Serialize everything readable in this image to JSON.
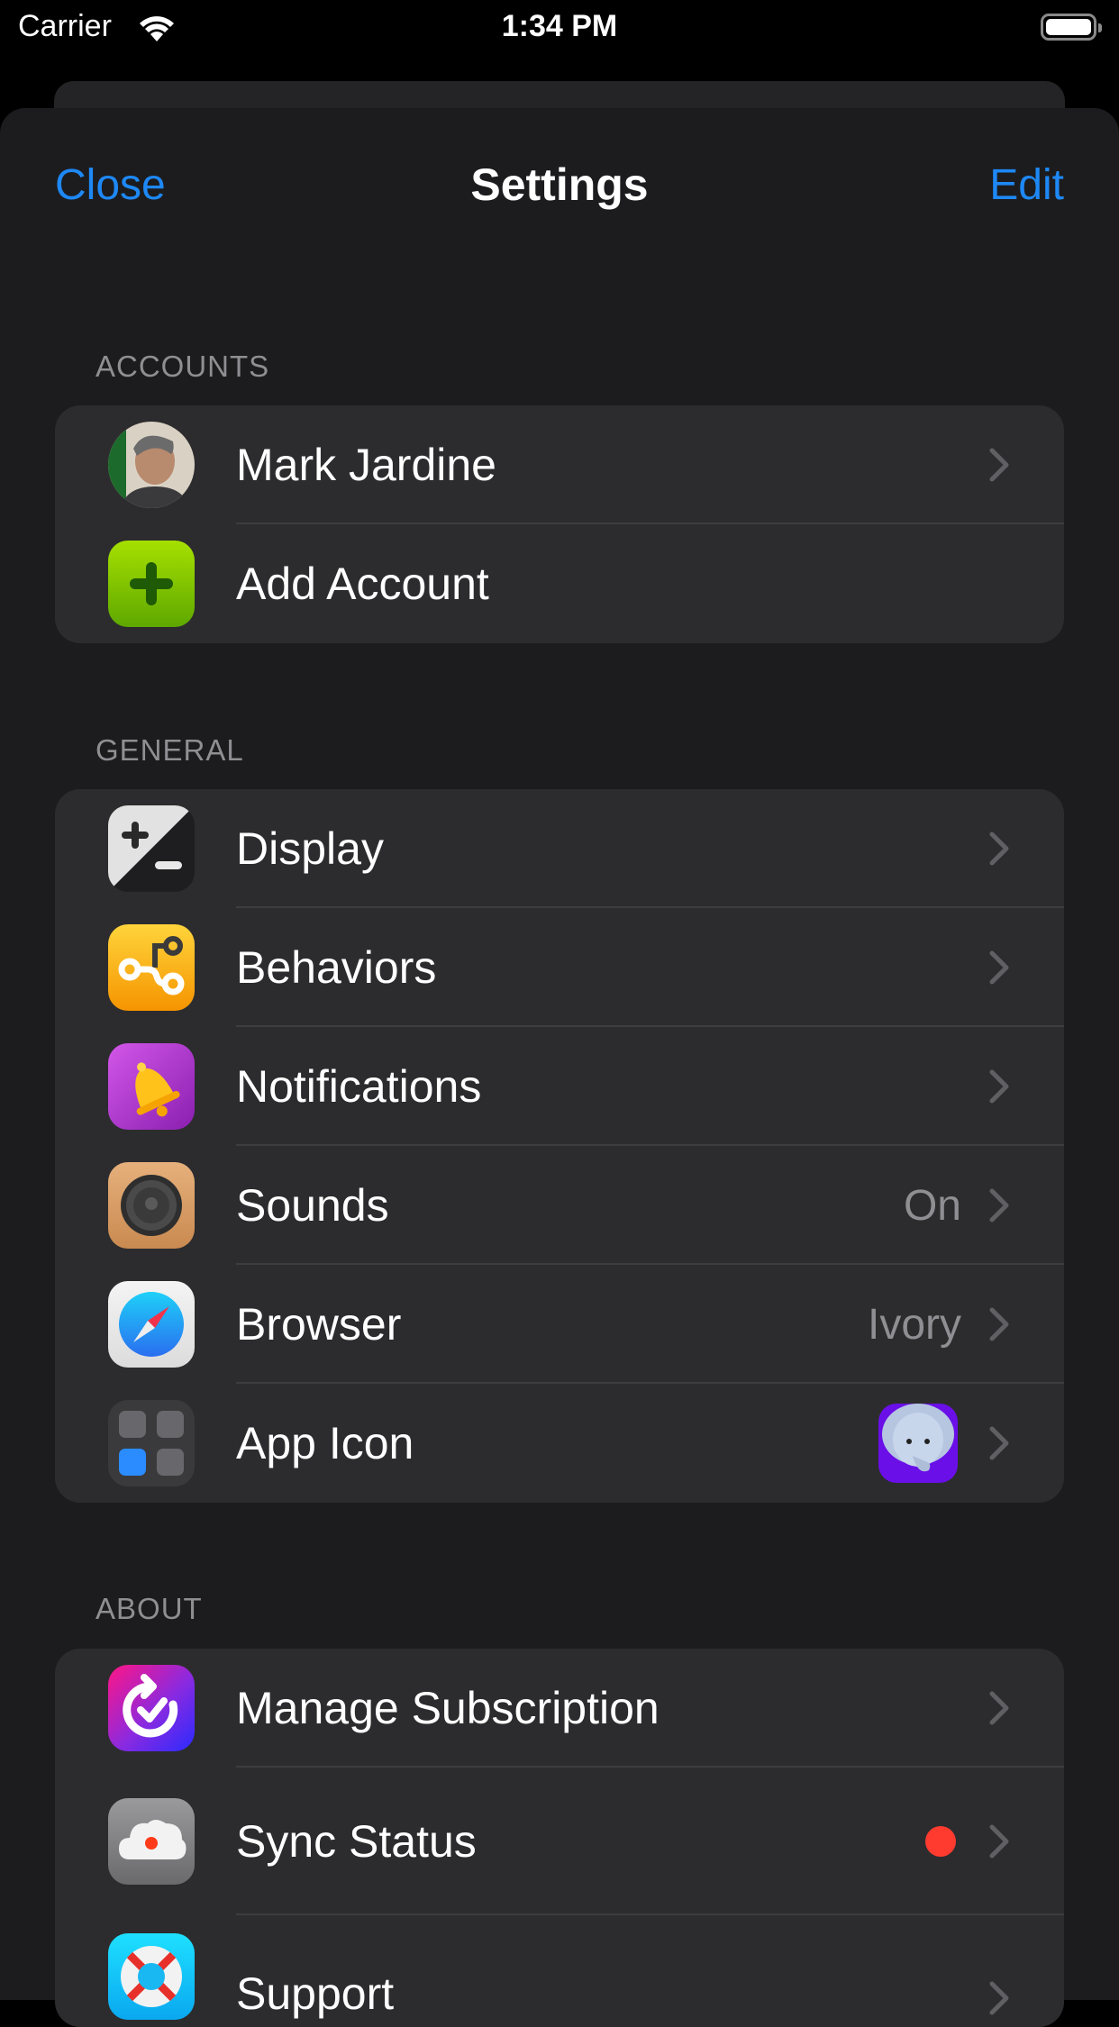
{
  "status_bar": {
    "carrier": "Carrier",
    "time": "1:34 PM",
    "wifi_icon": "wifi-icon",
    "battery_icon": "battery-icon"
  },
  "nav": {
    "title": "Settings",
    "close_label": "Close",
    "edit_label": "Edit",
    "accent_color": "#1e88f5"
  },
  "sections": {
    "accounts": {
      "header": "ACCOUNTS",
      "rows": [
        {
          "label": "Mark Jardine",
          "icon": "avatar",
          "has_chevron": true
        },
        {
          "label": "Add Account",
          "icon": "add-plus-icon",
          "has_chevron": false
        }
      ]
    },
    "general": {
      "header": "GENERAL",
      "rows": [
        {
          "label": "Display",
          "icon": "display-contrast-icon",
          "value": ""
        },
        {
          "label": "Behaviors",
          "icon": "behaviors-flow-icon",
          "value": ""
        },
        {
          "label": "Notifications",
          "icon": "bell-icon",
          "value": ""
        },
        {
          "label": "Sounds",
          "icon": "speaker-icon",
          "value": "On"
        },
        {
          "label": "Browser",
          "icon": "compass-icon",
          "value": "Ivory"
        },
        {
          "label": "App Icon",
          "icon": "app-grid-icon",
          "value_icon": "elephant-app-icon"
        }
      ]
    },
    "about": {
      "header": "ABOUT",
      "rows": [
        {
          "label": "Manage Subscription",
          "icon": "subscription-icon"
        },
        {
          "label": "Sync Status",
          "icon": "cloud-sync-icon",
          "status_color": "#ff3b30"
        },
        {
          "label": "Support",
          "icon": "lifebuoy-icon"
        }
      ]
    }
  }
}
